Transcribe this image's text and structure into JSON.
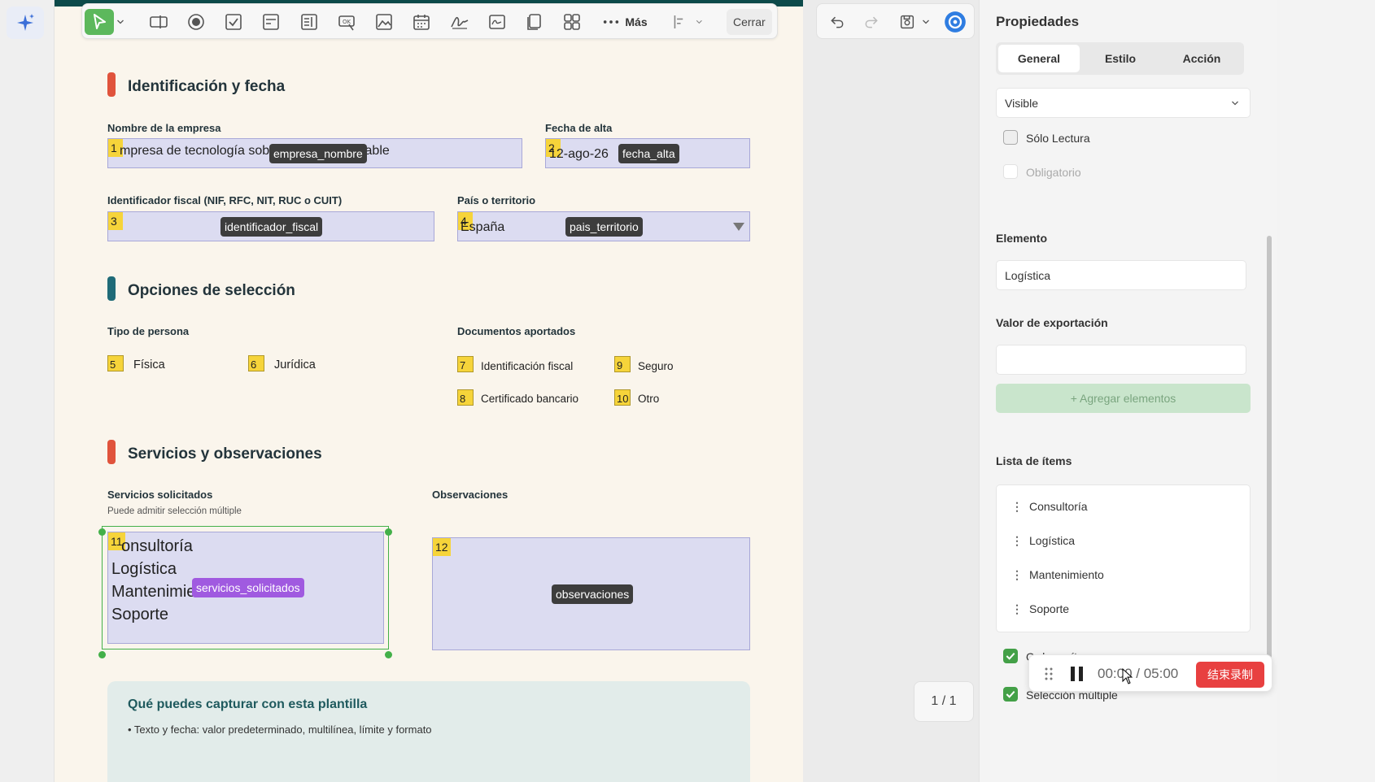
{
  "toolbar": {
    "more_label": "Más",
    "close_label": "Cerrar"
  },
  "form": {
    "sections": [
      {
        "title": "Identificación y fecha",
        "color": "#e0533c"
      },
      {
        "title": "Opciones de selección",
        "color": "#1f6b78"
      },
      {
        "title": "Servicios y observaciones",
        "color": "#e0533c"
      }
    ],
    "company_name": {
      "label": "Nombre de la empresa",
      "num": "1",
      "value": "mpresa de tecnología sobre energía renovable",
      "tag": "empresa_nombre"
    },
    "date": {
      "label": "Fecha de alta",
      "num": "2",
      "value": "12-ago-26",
      "tag": "fecha_alta"
    },
    "tax_id": {
      "label": "Identificador fiscal (NIF, RFC, NIT, RUC o CUIT)",
      "num": "3",
      "value": "",
      "tag": "identificador_fiscal"
    },
    "country": {
      "label": "País o territorio",
      "num": "4",
      "value": "España",
      "tag": "pais_territorio"
    },
    "person_type": {
      "label": "Tipo de persona",
      "options": [
        {
          "num": "5",
          "label": "Física"
        },
        {
          "num": "6",
          "label": "Jurídica"
        }
      ]
    },
    "documents": {
      "label": "Documentos aportados",
      "options": [
        {
          "num": "7",
          "label": "Identificación fiscal"
        },
        {
          "num": "9",
          "label": "Seguro"
        },
        {
          "num": "8",
          "label": "Certificado bancario"
        },
        {
          "num": "10",
          "label": "Otro"
        }
      ]
    },
    "services": {
      "label": "Servicios solicitados",
      "sublabel": "Puede admitir selección múltiple",
      "num": "11",
      "items": [
        "onsultoría",
        "Logística",
        "Mantenimie",
        "Soporte"
      ],
      "tag": "servicios_solicitados"
    },
    "observations": {
      "label": "Observaciones",
      "num": "12",
      "tag": "observaciones"
    },
    "info": {
      "title": "Qué puedes capturar con esta plantilla",
      "line": "• Texto y fecha: valor predeterminado, multilínea, límite y formato"
    }
  },
  "page_counter": "1 / 1",
  "panel": {
    "title": "Propiedades",
    "tabs": [
      "General",
      "Estilo",
      "Acción"
    ],
    "visibility": "Visible",
    "read_only": "Sólo Lectura",
    "required": "Obligatorio",
    "element_label": "Elemento",
    "element_value": "Logística",
    "export_label": "Valor de exportación",
    "export_value": "",
    "add_button": "+ Agregar elementos",
    "items_label": "Lista de ítems",
    "items": [
      "Consultoría",
      "Logística",
      "Mantenimiento",
      "Soporte"
    ],
    "option_partial": "Ordenar ít",
    "multiple_selection": "Selección múltiple"
  },
  "recording": {
    "time": "00:00 / 05:00",
    "stop_label": "结束录制"
  },
  "colors": {
    "accent_green": "#43a047",
    "field_fill": "#dcdcf1",
    "number_tag": "#f6d43a",
    "header_band": "#0c4a4a"
  }
}
